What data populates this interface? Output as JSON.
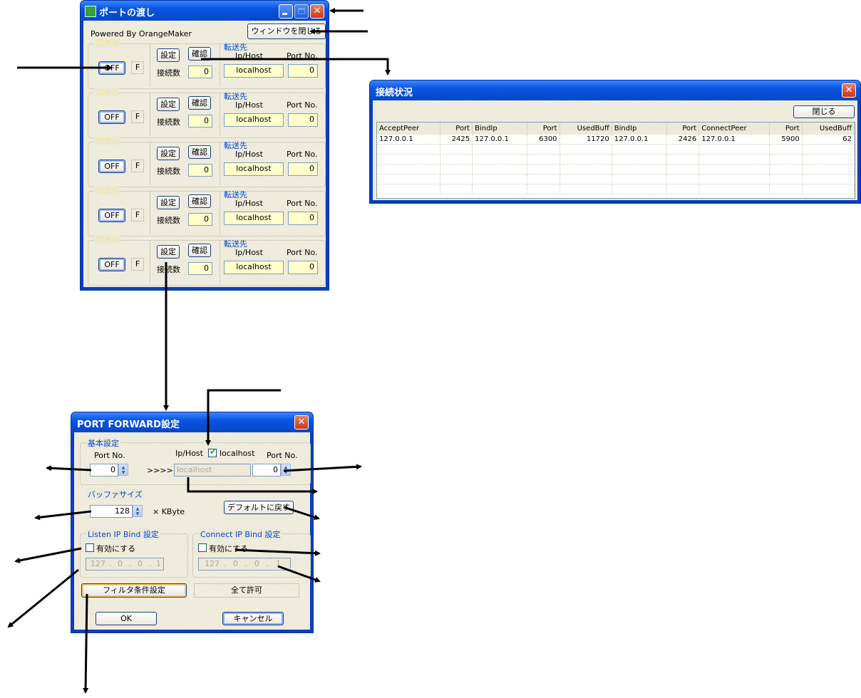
{
  "main_window": {
    "title": "ポートの渡し",
    "powered_by": "Powered By OrangeMaker",
    "close_window_button": "ウィンドウを閉じる",
    "channels": [
      {
        "group_label": "TCP:0",
        "toggle": "OFF",
        "flag": "F",
        "setting_button": "設定",
        "check_button": "確認",
        "conn_label": "接続数",
        "conn_count": "0",
        "dest_label": "転送先",
        "host_label": "Ip/Host",
        "port_label": "Port No.",
        "host": "localhost",
        "port": "0"
      },
      {
        "group_label": "TCP:0",
        "toggle": "OFF",
        "flag": "F",
        "setting_button": "設定",
        "check_button": "確認",
        "conn_label": "接続数",
        "conn_count": "0",
        "dest_label": "転送先",
        "host_label": "Ip/Host",
        "port_label": "Port No.",
        "host": "localhost",
        "port": "0"
      },
      {
        "group_label": "TCP:0",
        "toggle": "OFF",
        "flag": "F",
        "setting_button": "設定",
        "check_button": "確認",
        "conn_label": "接続数",
        "conn_count": "0",
        "dest_label": "転送先",
        "host_label": "Ip/Host",
        "port_label": "Port No.",
        "host": "localhost",
        "port": "0"
      },
      {
        "group_label": "TCP:0",
        "toggle": "OFF",
        "flag": "F",
        "setting_button": "設定",
        "check_button": "確認",
        "conn_label": "接続数",
        "conn_count": "0",
        "dest_label": "転送先",
        "host_label": "Ip/Host",
        "port_label": "Port No.",
        "host": "localhost",
        "port": "0"
      },
      {
        "group_label": "TCP:0",
        "toggle": "OFF",
        "flag": "F",
        "setting_button": "設定",
        "check_button": "確認",
        "conn_label": "接続数",
        "conn_count": "0",
        "dest_label": "転送先",
        "host_label": "Ip/Host",
        "port_label": "Port No.",
        "host": "localhost",
        "port": "0"
      }
    ]
  },
  "status_window": {
    "title": "接続状況",
    "close_button": "閉じる",
    "columns": [
      "AcceptPeer",
      "Port",
      "BindIp",
      "Port",
      "UsedBuff",
      "BindIp",
      "Port",
      "ConnectPeer",
      "Port",
      "UsedBuff"
    ],
    "rows": [
      [
        "127.0.0.1",
        "2425",
        "127.0.0.1",
        "6300",
        "11720",
        "127.0.0.1",
        "2426",
        "127.0.0.1",
        "5900",
        "62"
      ]
    ]
  },
  "forward_dialog": {
    "title": "PORT FORWARD設定",
    "basic_group": "基本設定",
    "port_label": "Port No.",
    "listen_port": "0",
    "arrow_text": ">>>>",
    "host_label": "Ip/Host",
    "localhost_check_label": "localhost",
    "localhost_checked": true,
    "host_value": "localhost",
    "dest_port_label": "Port No.",
    "dest_port": "0",
    "buffer_group": "バッファサイズ",
    "buffer_value": "128",
    "buffer_unit": "× KByte",
    "default_button": "デフォルトに戻す",
    "listen_group": "Listen IP Bind 設定",
    "listen_enable": "有効にする",
    "listen_ip": [
      "127",
      "0",
      "0",
      "1"
    ],
    "connect_group": "Connect IP Bind 設定",
    "connect_enable": "有効にする",
    "connect_ip": [
      "127",
      "0",
      "0",
      "1"
    ],
    "filter_button": "フィルタ条件設定",
    "filter_status": "全て許可",
    "ok_button": "OK",
    "cancel_button": "キャンセル"
  }
}
